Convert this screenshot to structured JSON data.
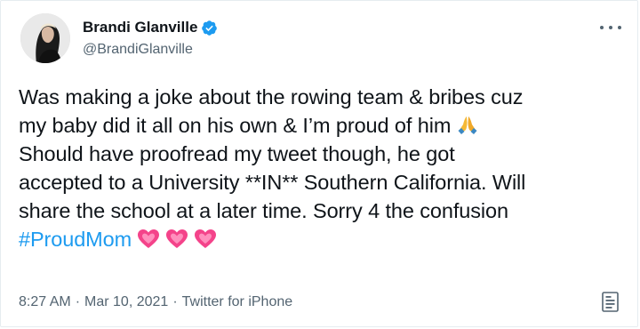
{
  "user": {
    "display_name": "Brandi Glanville",
    "handle": "@BrandiGlanville",
    "verified_icon": "verified-badge-icon",
    "avatar_icon": "avatar-photo"
  },
  "tweet": {
    "lines": [
      "Was making a joke about the rowing team & bribes cuz",
      "my baby did it all on his own & I’m proud of him",
      "Should have proofread my tweet though, he got",
      "accepted to a University **IN** Southern California. Will",
      "share the school at a later time. Sorry 4 the confusion"
    ],
    "hashtag": "#ProudMom",
    "emojis": [
      "folded-hands-icon",
      "heart-icon",
      "heart-icon",
      "heart-icon"
    ]
  },
  "meta": {
    "time": "8:27 AM",
    "date": "Mar 10, 2021",
    "source": "Twitter for iPhone",
    "separator": "·"
  },
  "colors": {
    "text": "#0f1419",
    "secondary": "#536471",
    "accent": "#1d9bf0",
    "heart": "#f4438a"
  }
}
